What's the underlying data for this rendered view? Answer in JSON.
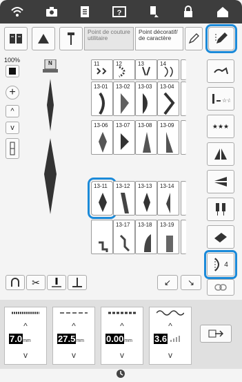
{
  "top_bar": {
    "icons": [
      "wifi-icon",
      "camera-icon",
      "document-icon",
      "help-icon",
      "thread-icon",
      "lock-icon",
      "home-icon"
    ]
  },
  "tabs": {
    "utility": "Point de couture utilitaire",
    "decorative": "Point décoratif/ de caractère"
  },
  "left_panel": {
    "zoom": "100%",
    "presser_foot": "N"
  },
  "stitch_grid": {
    "header_numbers": [
      "11",
      "12",
      "13",
      "14"
    ],
    "rows": [
      [
        "13-01",
        "13-02",
        "13-03",
        "13-04"
      ],
      [
        "13-06",
        "13-07",
        "13-08",
        "13-09"
      ],
      [
        "13-11",
        "13-12",
        "13-13",
        "13-14"
      ],
      [
        "",
        "13-17",
        "13-18",
        "13-19"
      ]
    ],
    "selected": "13-11"
  },
  "right_sidebar": {
    "stitch_count": "4",
    "combo_label": "★★★"
  },
  "controls": {
    "width": {
      "value": "7.0",
      "unit": "mm"
    },
    "length": {
      "value": "27.5",
      "unit": "mm"
    },
    "position": {
      "value": "0.00",
      "unit": "mm"
    },
    "density": {
      "value": "3.6"
    }
  },
  "colors": {
    "accent": "#1b8ad9",
    "topbar": "#3d3d3d"
  }
}
